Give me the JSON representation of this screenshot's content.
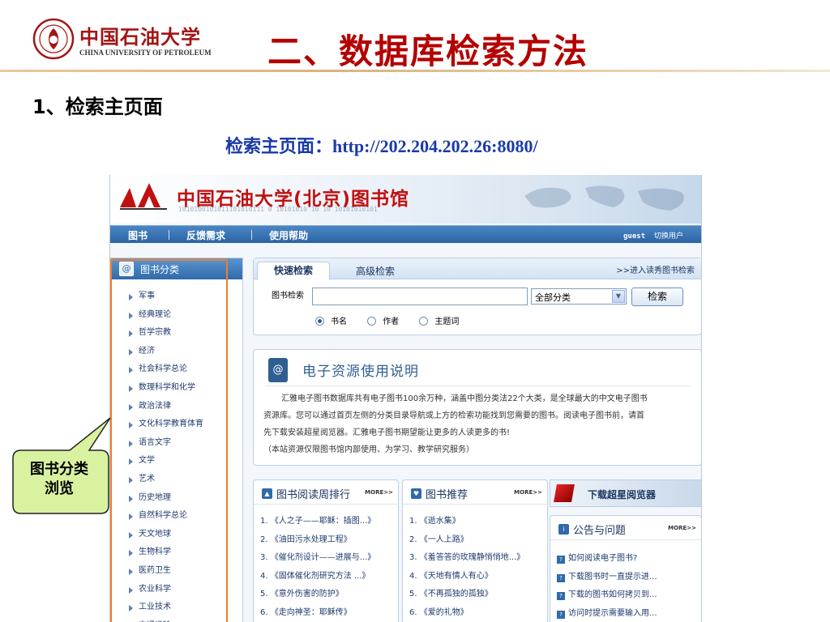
{
  "slide": {
    "university_cn": "中国石油大学",
    "university_en": "CHINA UNIVERSITY OF PETROLEUM",
    "title": "二、数据库检索方法",
    "section_heading": "1、检索主页面",
    "url_line": "检索主页面：http://202.204.202.26:8080/"
  },
  "library_page": {
    "banner_title": "中国石油大学(北京)图书馆",
    "banner_binary": "1010100101011101010111 0   10101010   10 10 10101010101",
    "nav": [
      "图书",
      "反馈需求",
      "使用帮助"
    ],
    "nav_user": "guest",
    "nav_switch": "切换用户",
    "category_panel": {
      "title": "图书分类",
      "items": [
        "军事",
        "经典理论",
        "哲学宗教",
        "经济",
        "社会科学总论",
        "数理科学和化学",
        "政治法律",
        "文化科学教育体育",
        "语言文字",
        "文学",
        "艺术",
        "历史地理",
        "自然科学总论",
        "天文地球",
        "生物科学",
        "医药卫生",
        "农业科学",
        "工业技术",
        "交通运输"
      ]
    },
    "search": {
      "tab_quick": "快速检索",
      "tab_advanced": "高级检索",
      "link_showcase": ">>进入读秀图书检索",
      "label": "图书检索",
      "input_value": "",
      "select_value": "全部分类",
      "button": "检索",
      "radios": [
        {
          "label": "书名",
          "checked": true
        },
        {
          "label": "作者",
          "checked": false
        },
        {
          "label": "主题词",
          "checked": false
        }
      ]
    },
    "resource": {
      "title": "电子资源使用说明",
      "lines": [
        "汇雅电子图书数据库共有电子图书100余万种，涵盖中图分类法22个大类，是全球最大的中文电子图书",
        "资源库。您可以通过首页左侧的分类目录导航或上方的检索功能找到您需要的图书。阅读电子图书前，请首",
        "先下载安装超星阅览器。汇雅电子图书期望能让更多的人读更多的书!",
        "（本站资源仅限图书馆内部使用、为学习、教学研究服务）"
      ]
    },
    "ranking": {
      "title": "图书阅读周排行",
      "more": "MORE>>",
      "items": [
        "1. 《人之子——耶稣：插图...》",
        "2. 《油田污水处理工程》",
        "3. 《催化剂设计——进展与...》",
        "4. 《固体催化剂研究方法 ...》",
        "5. 《意外伤害的防护》",
        "6. 《走向神圣：耶稣传》"
      ]
    },
    "recommend": {
      "title": "图书推荐",
      "more": "MORE>>",
      "items": [
        "1. 《逝水集》",
        "2. 《一人上路》",
        "3. 《羞答答的玫瑰静悄悄地...》",
        "4. 《天地有情人有心》",
        "5. 《不再孤独的孤独》",
        "6. 《爱的礼物》"
      ]
    },
    "reader_banner": "下载超星阅览器",
    "notice": {
      "title": "公告与问题",
      "more": "MORE>>",
      "items": [
        "如何阅读电子图书?",
        "下载图书时一直提示进...",
        "下载的图书如何拷贝到...",
        "访问时提示需要输入用..."
      ]
    }
  },
  "callout": {
    "line1": "图书分类",
    "line2": "浏览"
  },
  "colors": {
    "title_red": "#b40000",
    "url_blue": "#1a3aa8",
    "nav_blue": "#2b64a4",
    "highlight_orange": "#f07e2a",
    "callout_green": "#d9f2a0"
  }
}
